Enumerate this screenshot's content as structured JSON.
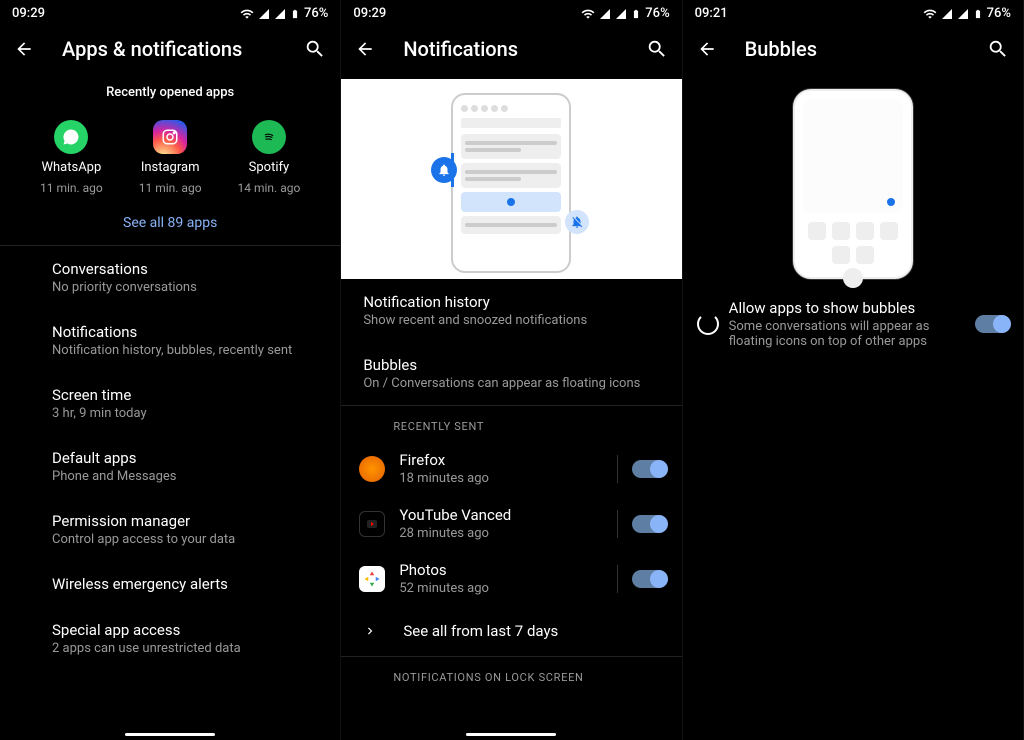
{
  "status": {
    "time1": "09:29",
    "time2": "09:29",
    "time3": "09:21",
    "battery": "76%"
  },
  "panel1": {
    "title": "Apps & notifications",
    "recent_label": "Recently opened apps",
    "apps": [
      {
        "name": "WhatsApp",
        "time": "11 min. ago"
      },
      {
        "name": "Instagram",
        "time": "11 min. ago"
      },
      {
        "name": "Spotify",
        "time": "14 min. ago"
      }
    ],
    "see_all": "See all 89 apps",
    "items": [
      {
        "title": "Conversations",
        "sub": "No priority conversations"
      },
      {
        "title": "Notifications",
        "sub": "Notification history, bubbles, recently sent"
      },
      {
        "title": "Screen time",
        "sub": "3 hr, 9 min today"
      },
      {
        "title": "Default apps",
        "sub": "Phone and Messages"
      },
      {
        "title": "Permission manager",
        "sub": "Control app access to your data"
      },
      {
        "title": "Wireless emergency alerts",
        "sub": ""
      },
      {
        "title": "Special app access",
        "sub": "2 apps can use unrestricted data"
      }
    ]
  },
  "panel2": {
    "title": "Notifications",
    "items": [
      {
        "title": "Notification history",
        "sub": "Show recent and snoozed notifications"
      },
      {
        "title": "Bubbles",
        "sub": "On / Conversations can appear as floating icons"
      }
    ],
    "recently_sent_header": "RECENTLY SENT",
    "recent": [
      {
        "name": "Firefox",
        "time": "18 minutes ago"
      },
      {
        "name": "YouTube Vanced",
        "time": "28 minutes ago"
      },
      {
        "name": "Photos",
        "time": "52 minutes ago"
      }
    ],
    "see_all": "See all from last 7 days",
    "lock_header": "NOTIFICATIONS ON LOCK SCREEN"
  },
  "panel3": {
    "title": "Bubbles",
    "toggle": {
      "title": "Allow apps to show bubbles",
      "sub": "Some conversations will appear as floating icons on top of other apps"
    }
  }
}
